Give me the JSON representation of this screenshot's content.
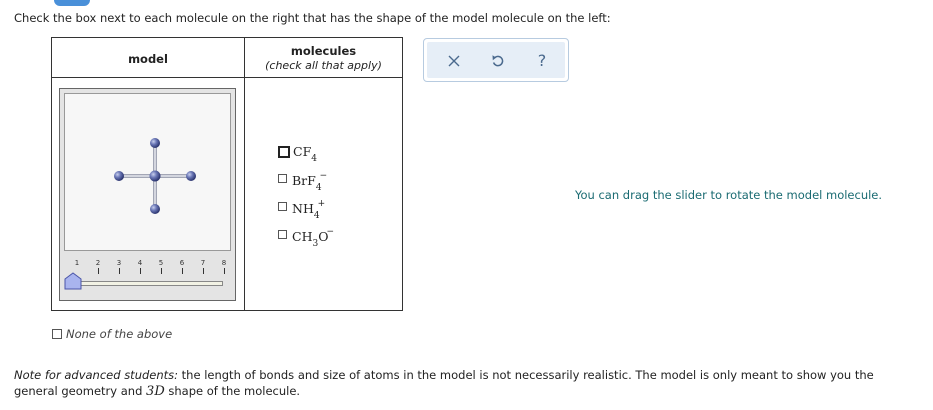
{
  "instruction": "Check the box next to each molecule on the right that has the shape of the model molecule on the left:",
  "table": {
    "model_header": "model",
    "molecules_header": "molecules",
    "molecules_subheader": "(check all that apply)"
  },
  "slider": {
    "ticks": [
      "1",
      "2",
      "3",
      "4",
      "5",
      "6",
      "7",
      "8"
    ],
    "current_value": 1
  },
  "choices": [
    {
      "base": "CF",
      "sub": "4",
      "charge": "",
      "checked": false,
      "focused": true
    },
    {
      "base": "BrF",
      "sub": "4",
      "charge": "−",
      "checked": false,
      "focused": false
    },
    {
      "base": "NH",
      "sub": "4",
      "charge": "+",
      "checked": false,
      "focused": false
    },
    {
      "base": "CH",
      "sub": "3",
      "base2": "O",
      "charge": "−",
      "checked": false,
      "focused": false
    }
  ],
  "toolbar": {
    "clear_icon": "x-icon",
    "undo_icon": "undo-icon",
    "help_label": "?"
  },
  "hint": "You can drag the slider to rotate the model molecule.",
  "none_label": "None of the above",
  "note": {
    "prefix": "Note for advanced students:",
    "body_before": "the length of bonds and size of atoms in the model is not necessarily realistic. The model is only meant to show you the general geometry and",
    "math": "3D",
    "body_after": "shape of the molecule."
  },
  "colors": {
    "atom": "#4d5a9c",
    "bond": "#b8bcc8",
    "hint_text": "#1a6b72",
    "toolbar_bg": "#e6eef7"
  }
}
